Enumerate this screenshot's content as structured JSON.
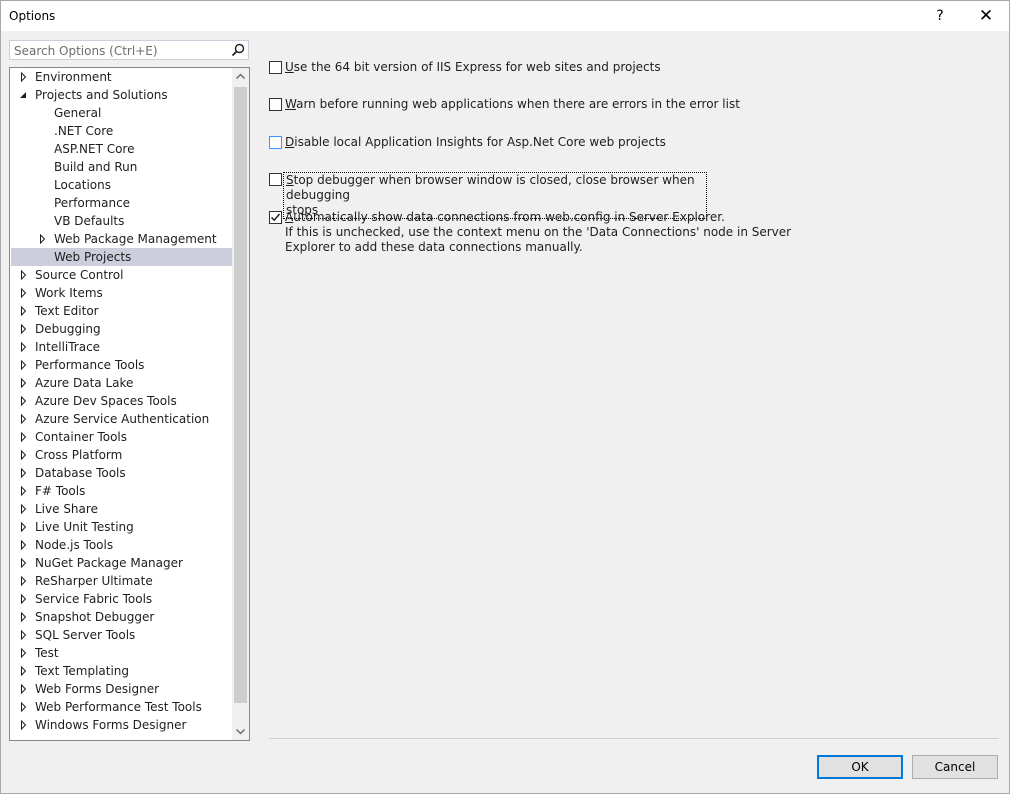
{
  "window": {
    "title": "Options",
    "help_glyph": "?",
    "close_glyph": "✕"
  },
  "search": {
    "placeholder": "Search Options (Ctrl+E)",
    "icon": "search-icon"
  },
  "tree": {
    "items": [
      {
        "label": "Environment",
        "expander": "collapsed",
        "level": 0
      },
      {
        "label": "Projects and Solutions",
        "expander": "expanded",
        "level": 0
      },
      {
        "label": "General",
        "expander": "none",
        "level": 1
      },
      {
        "label": ".NET Core",
        "expander": "none",
        "level": 1
      },
      {
        "label": "ASP.NET Core",
        "expander": "none",
        "level": 1
      },
      {
        "label": "Build and Run",
        "expander": "none",
        "level": 1
      },
      {
        "label": "Locations",
        "expander": "none",
        "level": 1
      },
      {
        "label": "Performance",
        "expander": "none",
        "level": 1
      },
      {
        "label": "VB Defaults",
        "expander": "none",
        "level": 1
      },
      {
        "label": "Web Package Management",
        "expander": "collapsed",
        "level": 1
      },
      {
        "label": "Web Projects",
        "expander": "none",
        "level": 1,
        "selected": true
      },
      {
        "label": "Source Control",
        "expander": "collapsed",
        "level": 0
      },
      {
        "label": "Work Items",
        "expander": "collapsed",
        "level": 0
      },
      {
        "label": "Text Editor",
        "expander": "collapsed",
        "level": 0
      },
      {
        "label": "Debugging",
        "expander": "collapsed",
        "level": 0
      },
      {
        "label": "IntelliTrace",
        "expander": "collapsed",
        "level": 0
      },
      {
        "label": "Performance Tools",
        "expander": "collapsed",
        "level": 0
      },
      {
        "label": "Azure Data Lake",
        "expander": "collapsed",
        "level": 0
      },
      {
        "label": "Azure Dev Spaces Tools",
        "expander": "collapsed",
        "level": 0
      },
      {
        "label": "Azure Service Authentication",
        "expander": "collapsed",
        "level": 0
      },
      {
        "label": "Container Tools",
        "expander": "collapsed",
        "level": 0
      },
      {
        "label": "Cross Platform",
        "expander": "collapsed",
        "level": 0
      },
      {
        "label": "Database Tools",
        "expander": "collapsed",
        "level": 0
      },
      {
        "label": "F# Tools",
        "expander": "collapsed",
        "level": 0
      },
      {
        "label": "Live Share",
        "expander": "collapsed",
        "level": 0
      },
      {
        "label": "Live Unit Testing",
        "expander": "collapsed",
        "level": 0
      },
      {
        "label": "Node.js Tools",
        "expander": "collapsed",
        "level": 0
      },
      {
        "label": "NuGet Package Manager",
        "expander": "collapsed",
        "level": 0
      },
      {
        "label": "ReSharper Ultimate",
        "expander": "collapsed",
        "level": 0
      },
      {
        "label": "Service Fabric Tools",
        "expander": "collapsed",
        "level": 0
      },
      {
        "label": "Snapshot Debugger",
        "expander": "collapsed",
        "level": 0
      },
      {
        "label": "SQL Server Tools",
        "expander": "collapsed",
        "level": 0
      },
      {
        "label": "Test",
        "expander": "collapsed",
        "level": 0
      },
      {
        "label": "Text Templating",
        "expander": "collapsed",
        "level": 0
      },
      {
        "label": "Web Forms Designer",
        "expander": "collapsed",
        "level": 0
      },
      {
        "label": "Web Performance Test Tools",
        "expander": "collapsed",
        "level": 0
      },
      {
        "label": "Windows Forms Designer",
        "expander": "collapsed",
        "level": 0
      }
    ]
  },
  "options": [
    {
      "mnemonic": "U",
      "rest": "se the 64 bit version of IIS Express for web sites and projects",
      "checked": false
    },
    {
      "mnemonic": "W",
      "rest": "arn before running web applications when there are errors in the error list",
      "checked": false
    },
    {
      "mnemonic": "D",
      "rest": "isable local Application Insights for Asp.Net Core web projects",
      "checked": false
    },
    {
      "mnemonic": "S",
      "rest": "top debugger when browser window is closed, close browser when debugging",
      "line2": "stops",
      "checked": false
    },
    {
      "mnemonic": "A",
      "rest": "utomatically show data connections from web.config in Server Explorer.",
      "checked": true
    }
  ],
  "options_note": {
    "line1": "If this is unchecked, use the context menu on the 'Data Connections' node in Server",
    "line2": "Explorer to add these data connections manually."
  },
  "buttons": {
    "ok": "OK",
    "cancel": "Cancel"
  }
}
